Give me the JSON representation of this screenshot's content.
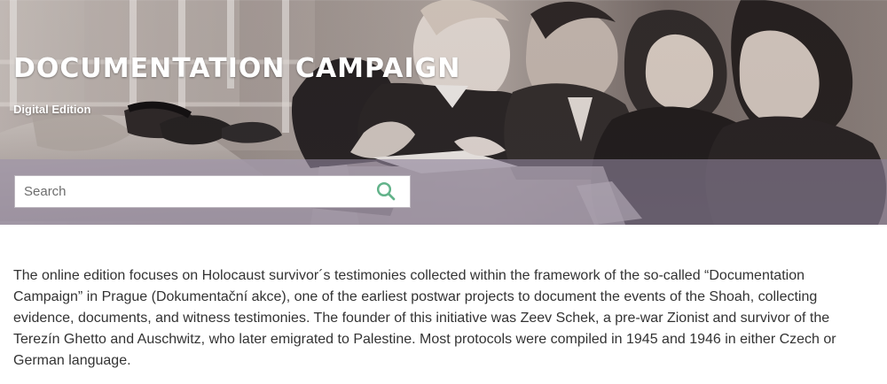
{
  "hero": {
    "title": "DOCUMENTATION CAMPAIGN",
    "subtitle": "Digital Edition"
  },
  "search": {
    "placeholder": "Search",
    "icon": "search-icon",
    "accent_color": "#62b38a"
  },
  "main": {
    "description": "The online edition focuses on Holocaust survivor´s testimonies collected within the framework of the so-called “Documentation Campaign” in Prague (Dokumentační akce), one of the earliest postwar projects to document the events of the Shoah, collecting evidence, documents, and witness testimonies. The founder of this initiative was Zeev Schek, a pre-war Zionist and survivor of the Terezín Ghetto and Auschwitz, who later emigrated to Palestine. Most protocols were compiled in 1945 and 1946 in either Czech or German language."
  },
  "colors": {
    "text": "#333333",
    "header_text": "#ffffff",
    "search_band": "#8e829a"
  }
}
